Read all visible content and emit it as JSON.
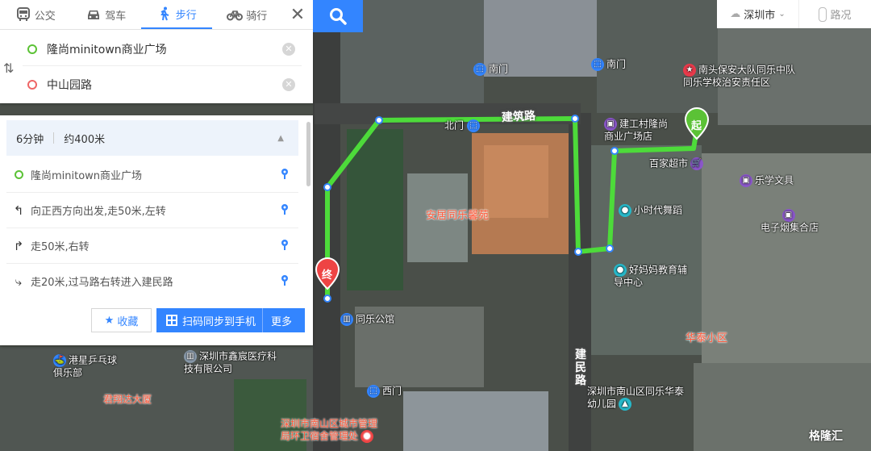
{
  "modes": [
    {
      "label": "公交",
      "icon": "bus-icon"
    },
    {
      "label": "驾车",
      "icon": "car-icon"
    },
    {
      "label": "步行",
      "icon": "walk-icon"
    },
    {
      "label": "骑行",
      "icon": "bike-icon"
    }
  ],
  "active_mode": "步行",
  "route": {
    "start": "隆尚minitown商业广场",
    "end": "中山园路"
  },
  "summary": {
    "time": "6分钟",
    "distance": "约400米"
  },
  "steps": [
    {
      "icon": "start-dot-icon",
      "text": "隆尚minitown商业广场"
    },
    {
      "icon": "turn-left-icon",
      "text": "向正西方向出发,走50米,左转"
    },
    {
      "icon": "turn-right-icon",
      "text": "走50米,右转"
    },
    {
      "icon": "cross-road-right-icon",
      "text": "走20米,过马路右转进入建民路"
    }
  ],
  "buttons": {
    "favorite": "收藏",
    "sync": "扫码同步到手机",
    "more": "更多"
  },
  "city": "深圳市",
  "traffic": "路况",
  "map": {
    "start_marker": "起",
    "end_marker": "终",
    "roads": [
      "建筑路",
      "建民路"
    ],
    "pois": [
      {
        "name": "南门"
      },
      {
        "name": "南门 "
      },
      {
        "name": "北门"
      },
      {
        "name": "南头保安大队同乐中队同乐学校治安责任区"
      },
      {
        "name": "建工村隆尚商业广场店"
      },
      {
        "name": "百家超市"
      },
      {
        "name": "乐学文具"
      },
      {
        "name": "小时代舞蹈"
      },
      {
        "name": "电子烟集合店"
      },
      {
        "name": "好妈妈教育辅导中心"
      },
      {
        "name": "安居同乐馨苑"
      },
      {
        "name": "同乐公馆"
      },
      {
        "name": "华泰小区"
      },
      {
        "name": "港星乒乓球俱乐部"
      },
      {
        "name": "深圳市鑫宸医疗科技有限公司"
      },
      {
        "name": "君翔达大厦"
      },
      {
        "name": "西门"
      },
      {
        "name": "深圳市南山区同乐华泰幼儿园"
      },
      {
        "name": "深圳市南山区城市管理局环卫宿舍管理处"
      }
    ]
  },
  "watermark": "格隆汇",
  "colors": {
    "accent": "#3385ff",
    "route": "#4ddb3a",
    "start": "#5bc236",
    "end": "#ee4444"
  }
}
